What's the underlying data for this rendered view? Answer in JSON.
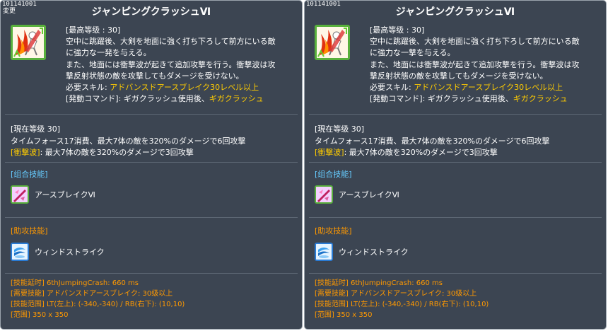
{
  "panels": [
    {
      "skill_id": "101141001",
      "changed_tag": "変更",
      "title": "ジャンピングクラッシュⅥ",
      "icon": "jumping-crash-skill-icon",
      "desc": {
        "line1": "[最高等级 : 30]",
        "line2": "空中に跳躍後、大剣を地面に強く打ち下ろして前方にいる敵",
        "line3": "に強力な一発を与える。",
        "line4": "また、地面には衝撃波が起きて追加攻撃を行う。衝撃波は攻",
        "line5": "撃反射状態の敵を攻撃してもダメージを受けない。",
        "req_label": "必要スキル: ",
        "req_value": "アドバンスドアースブレイク30レベル以上",
        "cmd_label": "[発動コマンド]: ギガクラッシュ使用後、",
        "cmd_value": "ギガクラッシュ"
      },
      "current": {
        "heading": "[現在等级 30]",
        "line1": "タイムフォース17消費、最大7体の敵を320%のダメージで6回攻撃",
        "shock_label": "[衝撃波]",
        "shock_text": ": 最大7体の敵を320%のダメージで3回攻撃"
      },
      "combo": {
        "heading": "[组合技能]",
        "skill_name": "アースブレイクⅥ",
        "icon": "earth-break-skill-icon"
      },
      "assist": {
        "heading": "[助攻技能]",
        "skill_name": "ウィンドストライク",
        "icon": "wind-strike-skill-icon"
      },
      "info": {
        "delay_label": "[技能延时]",
        "delay_value": " 6thJumpingCrash: 660 ms",
        "req_label": "[需要技能]",
        "req_value": " アドバンスドアースブレイク: 30级以上",
        "range_label": "[技能范围]",
        "range_value": " LT(左上): (-340,-340) / RB(右下): (10,10)",
        "area_label": "[范围]",
        "area_value": " 350 x 350"
      }
    },
    {
      "skill_id": "101141001",
      "changed_tag": "",
      "title": "ジャンピングクラッシュⅥ",
      "icon": "jumping-crash-skill-icon",
      "desc": {
        "line1": "[最高等级 : 30]",
        "line2": "空中に跳躍後、大剣を地面に強く打ち下ろして前方にいる敵",
        "line3": "に強力な一撃を与える。",
        "line4": "また、地面には衝撃波が起きて追加攻撃を行う。衝撃波は攻",
        "line5": "撃反射状態の敵を攻撃してもダメージを受けない。",
        "req_label": "必要スキル: ",
        "req_value": "アドバンスドアースブレイク30レベル以上",
        "cmd_label": "[発動コマンド]: ギガクラッシュ使用後、",
        "cmd_value": "ギガクラッシュ"
      },
      "current": {
        "heading": "[現在等级 30]",
        "line1": "タイムフォース17消費、最大7体の敵を320%のダメージで6回攻撃",
        "shock_label": "[衝撃波]",
        "shock_text": ": 最大7体の敵を320%のダメージで3回攻撃"
      },
      "combo": {
        "heading": "[组合技能]",
        "skill_name": "アースブレイクⅥ",
        "icon": "earth-break-skill-icon"
      },
      "assist": {
        "heading": "[助攻技能]",
        "skill_name": "ウィンドストライク",
        "icon": "wind-strike-skill-icon"
      },
      "info": {
        "delay_label": "[技能延时]",
        "delay_value": " 6thJumpingCrash: 660 ms",
        "req_label": "[需要技能]",
        "req_value": " アドバンスドアースブレイク: 30级以上",
        "range_label": "[技能范围]",
        "range_value": " LT(左上): (-340,-340) / RB(右下): (10,10)",
        "area_label": "[范围]",
        "area_value": " 350 x 350"
      }
    }
  ],
  "colors": {
    "panel_bg": "#3c4552",
    "text": "#ffffff",
    "highlight_yellow": "#ffcc00",
    "info_orange": "#ff9900",
    "heading_cyan": "#66ccff",
    "icon_border_green": "#58b03c"
  }
}
